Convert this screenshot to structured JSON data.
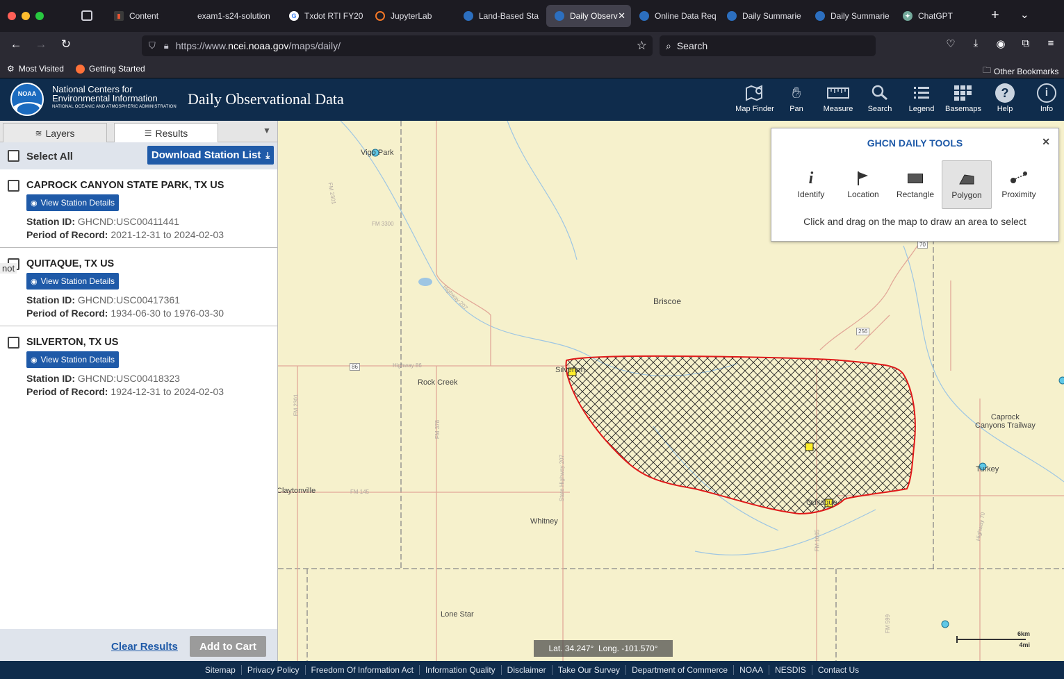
{
  "browser": {
    "tabs": [
      {
        "label": "Content"
      },
      {
        "label": "exam1-s24-solution"
      },
      {
        "label": "Txdot RTI FY20"
      },
      {
        "label": "JupyterLab"
      },
      {
        "label": "Land-Based Sta"
      },
      {
        "label": "Daily Observ"
      },
      {
        "label": "Online Data Req"
      },
      {
        "label": "Daily Summarie"
      },
      {
        "label": "Daily Summarie"
      },
      {
        "label": "ChatGPT"
      }
    ],
    "url_prefix": "https://www.",
    "url_domain": "ncei.noaa.gov",
    "url_path": "/maps/daily/",
    "search_placeholder": "Search",
    "bookmarks": {
      "most_visited": "Most Visited",
      "getting_started": "Getting Started",
      "other": "Other Bookmarks"
    }
  },
  "header": {
    "org_line1": "National Centers for",
    "org_line2": "Environmental Information",
    "org_line3": "NATIONAL OCEANIC AND ATMOSPHERIC ADMINISTRATION",
    "logo_text": "NOAA",
    "title": "Daily Observational Data",
    "tools": [
      {
        "label": "Map Finder"
      },
      {
        "label": "Pan"
      },
      {
        "label": "Measure"
      },
      {
        "label": "Search"
      },
      {
        "label": "Legend"
      },
      {
        "label": "Basemaps"
      },
      {
        "label": "Help"
      },
      {
        "label": "Info"
      }
    ]
  },
  "panel": {
    "tab_layers": "Layers",
    "tab_results": "Results",
    "select_all": "Select All",
    "download": "Download Station List",
    "view_details": "View Station Details",
    "id_label": "Station ID:",
    "period_label": "Period of Record:",
    "stations": [
      {
        "name": "CAPROCK CANYON STATE PARK, TX US",
        "id": "GHCND:USC00411441",
        "period": "2021-12-31 to 2024-02-03"
      },
      {
        "name": "QUITAQUE, TX US",
        "id": "GHCND:USC00417361",
        "period": "1934-06-30 to 1976-03-30"
      },
      {
        "name": "SILVERTON, TX US",
        "id": "GHCND:USC00418323",
        "period": "1924-12-31 to 2024-02-03"
      }
    ],
    "tooltip_fragment": "not",
    "clear": "Clear Results",
    "add_cart": "Add to Cart"
  },
  "ghcn": {
    "title": "GHCN DAILY TOOLS",
    "tools": [
      {
        "label": "Identify"
      },
      {
        "label": "Location"
      },
      {
        "label": "Rectangle"
      },
      {
        "label": "Polygon"
      },
      {
        "label": "Proximity"
      }
    ],
    "instructions": "Click and drag on the map to draw an area to select"
  },
  "map": {
    "places": [
      "Vigo Park",
      "Briscoe",
      "Rock Creek",
      "Silverton",
      "Claytonville",
      "Whitney",
      "Lone Star",
      "Caprock\nCanyons Trailway",
      "Turkey",
      "Quitaque"
    ],
    "roads": [
      "FM 2301",
      "FM 3300",
      "Highway 207",
      "Highway 86",
      "FM 378",
      "FM 145",
      "State Highway 207",
      "FM 1065",
      "FM 599",
      "Highway 70",
      "FM 2301",
      "86",
      "256",
      "70"
    ],
    "coords": "Lat. 34.247°  Long. -101.570°",
    "scale_km": "6km",
    "scale_mi": "4mi"
  },
  "footer": [
    "Sitemap",
    "Privacy Policy",
    "Freedom Of Information Act",
    "Information Quality",
    "Disclaimer",
    "Take Our Survey",
    "Department of Commerce",
    "NOAA",
    "NESDIS",
    "Contact Us"
  ]
}
